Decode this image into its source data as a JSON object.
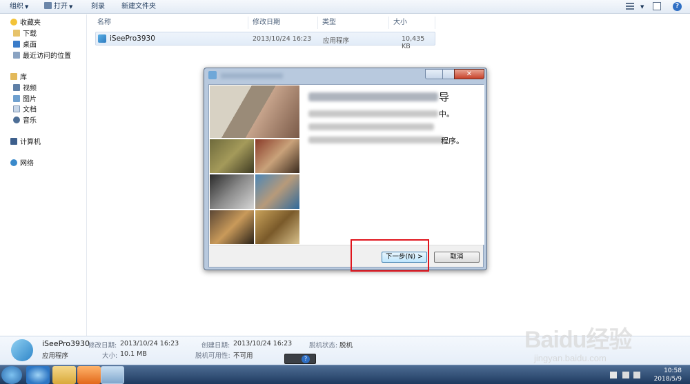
{
  "toolbar": {
    "organize": "组织",
    "open": "打开",
    "burn": "刻录",
    "new_folder": "新建文件夹"
  },
  "nav": {
    "favorites": "收藏夹",
    "downloads": "下载",
    "desktop": "桌面",
    "recent": "最近访问的位置",
    "libraries": "库",
    "videos": "视频",
    "pictures": "图片",
    "documents": "文档",
    "music": "音乐",
    "computer": "计算机",
    "network": "网络"
  },
  "columns": {
    "name": "名称",
    "date": "修改日期",
    "type": "类型",
    "size": "大小"
  },
  "file": {
    "name": "iSeePro3930",
    "date": "2013/10/24 16:23",
    "type": "应用程序",
    "size": "10,435 KB"
  },
  "dialog": {
    "title_tail": "导",
    "line1_tail": "中。",
    "line3_tail": "程序。",
    "next_label": "下一步(N) >",
    "cancel_label": "取消"
  },
  "details": {
    "name": "iSeePro3930",
    "kind": "应用程序",
    "modified_label": "修改日期:",
    "modified": "2013/10/24 16:23",
    "size_label": "大小:",
    "size": "10.1 MB",
    "created_label": "创建日期:",
    "created": "2013/10/24 16:23",
    "offline_label": "脱机状态:",
    "offline": "脱机",
    "availability_label": "脱机可用性:",
    "availability": "不可用"
  },
  "taskbar": {
    "time": "10:58",
    "date": "2018/5/9"
  },
  "watermark": {
    "brand": "Baidu经验",
    "url": "jingyan.baidu.com"
  },
  "colors": {
    "highlight_box": "#e0141c",
    "taskbar": "#1e3a5f"
  }
}
